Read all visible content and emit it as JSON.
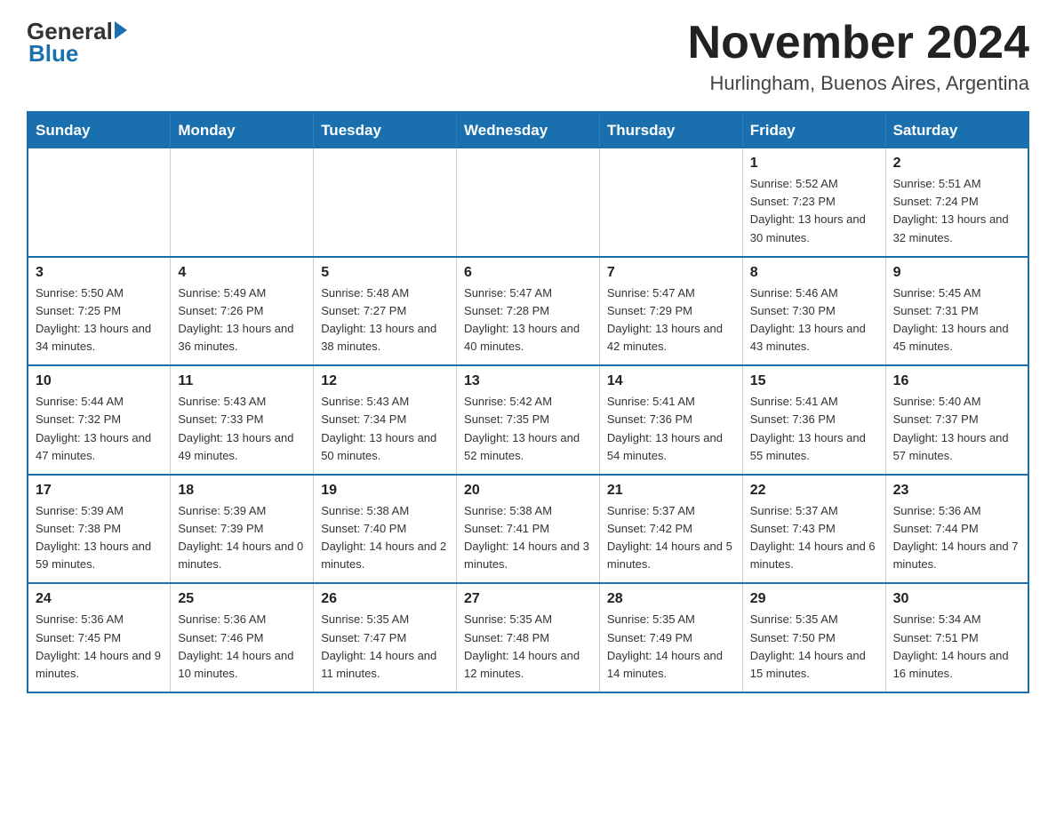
{
  "logo": {
    "general": "General",
    "blue": "Blue"
  },
  "title": "November 2024",
  "location": "Hurlingham, Buenos Aires, Argentina",
  "weekdays": [
    "Sunday",
    "Monday",
    "Tuesday",
    "Wednesday",
    "Thursday",
    "Friday",
    "Saturday"
  ],
  "weeks": [
    [
      {
        "day": "",
        "info": ""
      },
      {
        "day": "",
        "info": ""
      },
      {
        "day": "",
        "info": ""
      },
      {
        "day": "",
        "info": ""
      },
      {
        "day": "",
        "info": ""
      },
      {
        "day": "1",
        "info": "Sunrise: 5:52 AM\nSunset: 7:23 PM\nDaylight: 13 hours and 30 minutes."
      },
      {
        "day": "2",
        "info": "Sunrise: 5:51 AM\nSunset: 7:24 PM\nDaylight: 13 hours and 32 minutes."
      }
    ],
    [
      {
        "day": "3",
        "info": "Sunrise: 5:50 AM\nSunset: 7:25 PM\nDaylight: 13 hours and 34 minutes."
      },
      {
        "day": "4",
        "info": "Sunrise: 5:49 AM\nSunset: 7:26 PM\nDaylight: 13 hours and 36 minutes."
      },
      {
        "day": "5",
        "info": "Sunrise: 5:48 AM\nSunset: 7:27 PM\nDaylight: 13 hours and 38 minutes."
      },
      {
        "day": "6",
        "info": "Sunrise: 5:47 AM\nSunset: 7:28 PM\nDaylight: 13 hours and 40 minutes."
      },
      {
        "day": "7",
        "info": "Sunrise: 5:47 AM\nSunset: 7:29 PM\nDaylight: 13 hours and 42 minutes."
      },
      {
        "day": "8",
        "info": "Sunrise: 5:46 AM\nSunset: 7:30 PM\nDaylight: 13 hours and 43 minutes."
      },
      {
        "day": "9",
        "info": "Sunrise: 5:45 AM\nSunset: 7:31 PM\nDaylight: 13 hours and 45 minutes."
      }
    ],
    [
      {
        "day": "10",
        "info": "Sunrise: 5:44 AM\nSunset: 7:32 PM\nDaylight: 13 hours and 47 minutes."
      },
      {
        "day": "11",
        "info": "Sunrise: 5:43 AM\nSunset: 7:33 PM\nDaylight: 13 hours and 49 minutes."
      },
      {
        "day": "12",
        "info": "Sunrise: 5:43 AM\nSunset: 7:34 PM\nDaylight: 13 hours and 50 minutes."
      },
      {
        "day": "13",
        "info": "Sunrise: 5:42 AM\nSunset: 7:35 PM\nDaylight: 13 hours and 52 minutes."
      },
      {
        "day": "14",
        "info": "Sunrise: 5:41 AM\nSunset: 7:36 PM\nDaylight: 13 hours and 54 minutes."
      },
      {
        "day": "15",
        "info": "Sunrise: 5:41 AM\nSunset: 7:36 PM\nDaylight: 13 hours and 55 minutes."
      },
      {
        "day": "16",
        "info": "Sunrise: 5:40 AM\nSunset: 7:37 PM\nDaylight: 13 hours and 57 minutes."
      }
    ],
    [
      {
        "day": "17",
        "info": "Sunrise: 5:39 AM\nSunset: 7:38 PM\nDaylight: 13 hours and 59 minutes."
      },
      {
        "day": "18",
        "info": "Sunrise: 5:39 AM\nSunset: 7:39 PM\nDaylight: 14 hours and 0 minutes."
      },
      {
        "day": "19",
        "info": "Sunrise: 5:38 AM\nSunset: 7:40 PM\nDaylight: 14 hours and 2 minutes."
      },
      {
        "day": "20",
        "info": "Sunrise: 5:38 AM\nSunset: 7:41 PM\nDaylight: 14 hours and 3 minutes."
      },
      {
        "day": "21",
        "info": "Sunrise: 5:37 AM\nSunset: 7:42 PM\nDaylight: 14 hours and 5 minutes."
      },
      {
        "day": "22",
        "info": "Sunrise: 5:37 AM\nSunset: 7:43 PM\nDaylight: 14 hours and 6 minutes."
      },
      {
        "day": "23",
        "info": "Sunrise: 5:36 AM\nSunset: 7:44 PM\nDaylight: 14 hours and 7 minutes."
      }
    ],
    [
      {
        "day": "24",
        "info": "Sunrise: 5:36 AM\nSunset: 7:45 PM\nDaylight: 14 hours and 9 minutes."
      },
      {
        "day": "25",
        "info": "Sunrise: 5:36 AM\nSunset: 7:46 PM\nDaylight: 14 hours and 10 minutes."
      },
      {
        "day": "26",
        "info": "Sunrise: 5:35 AM\nSunset: 7:47 PM\nDaylight: 14 hours and 11 minutes."
      },
      {
        "day": "27",
        "info": "Sunrise: 5:35 AM\nSunset: 7:48 PM\nDaylight: 14 hours and 12 minutes."
      },
      {
        "day": "28",
        "info": "Sunrise: 5:35 AM\nSunset: 7:49 PM\nDaylight: 14 hours and 14 minutes."
      },
      {
        "day": "29",
        "info": "Sunrise: 5:35 AM\nSunset: 7:50 PM\nDaylight: 14 hours and 15 minutes."
      },
      {
        "day": "30",
        "info": "Sunrise: 5:34 AM\nSunset: 7:51 PM\nDaylight: 14 hours and 16 minutes."
      }
    ]
  ]
}
